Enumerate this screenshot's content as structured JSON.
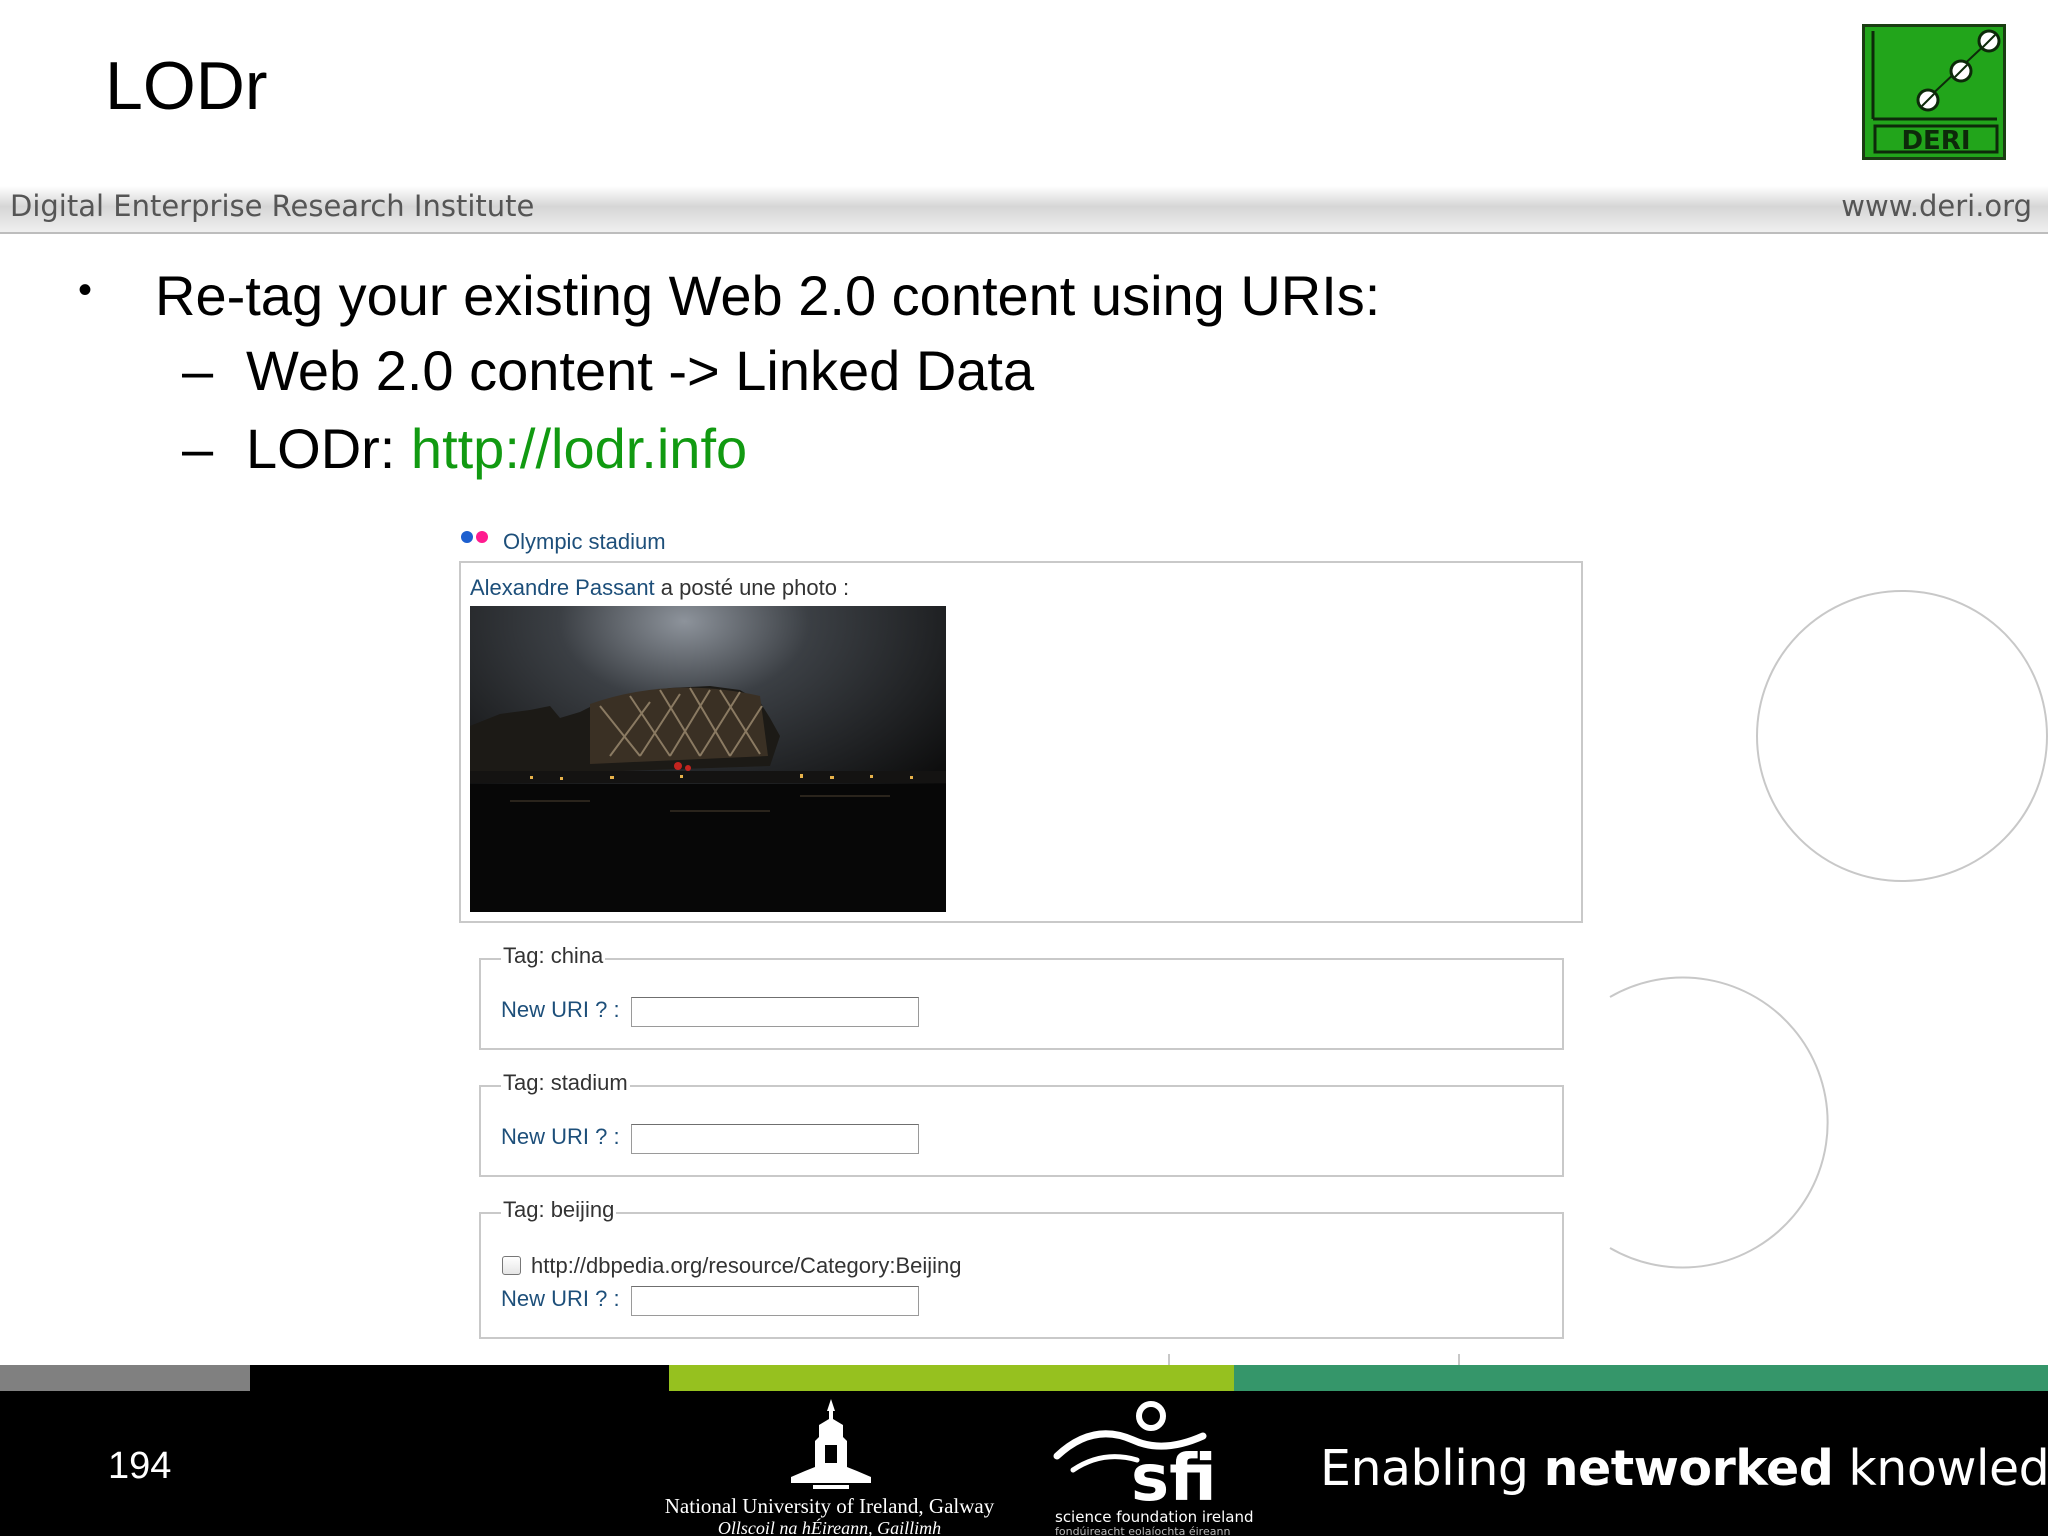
{
  "slide": {
    "title": "LODr",
    "institute": "Digital Enterprise Research Institute",
    "website": "www.deri.org",
    "logo_text": "DERI",
    "bullet": "Re-tag your existing Web 2.0 content using URIs:",
    "sub_items": [
      {
        "dash": "–",
        "text": "Web 2.0 content -> Linked Data",
        "link": ""
      },
      {
        "dash": "–",
        "text": "LODr: ",
        "link": "http://lodr.info"
      }
    ],
    "page_number": "194"
  },
  "lodr_app": {
    "photo_title": "Olympic stadium",
    "author": "Alexandre Passant",
    "posted_text": " a posté une photo :",
    "tags": [
      {
        "legend": "Tag: china",
        "uri_label": "New URI ? :",
        "input_value": ""
      },
      {
        "legend": "Tag: stadium",
        "uri_label": "New URI ? :",
        "input_value": ""
      },
      {
        "legend": "Tag: beijing",
        "suggestion": "http://dbpedia.org/resource/Category:Beijing",
        "suggestion_checked": false,
        "uri_label": "New URI ? :",
        "input_value": ""
      }
    ]
  },
  "footer": {
    "nuig_name": "National University of Ireland, Galway",
    "nuig_irish": "Ollscoil na hÉireann, Gaillimh",
    "sfi_logo": "sfi",
    "sfi_line_1": "science foundation ireland",
    "sfi_line_2": "fondúireacht eolaíochta éireann",
    "tagline_pre": "Enabling ",
    "tagline_bold": "networked",
    "tagline_post": " knowledge."
  },
  "colors": {
    "link_green": "#119a11",
    "app_link_blue": "#1d4f7a",
    "deri_green": "#22a51b",
    "bar_gray": "#808080",
    "bar_black": "#000000",
    "bar_lime": "#96c11f",
    "bar_teal": "#35966a"
  }
}
